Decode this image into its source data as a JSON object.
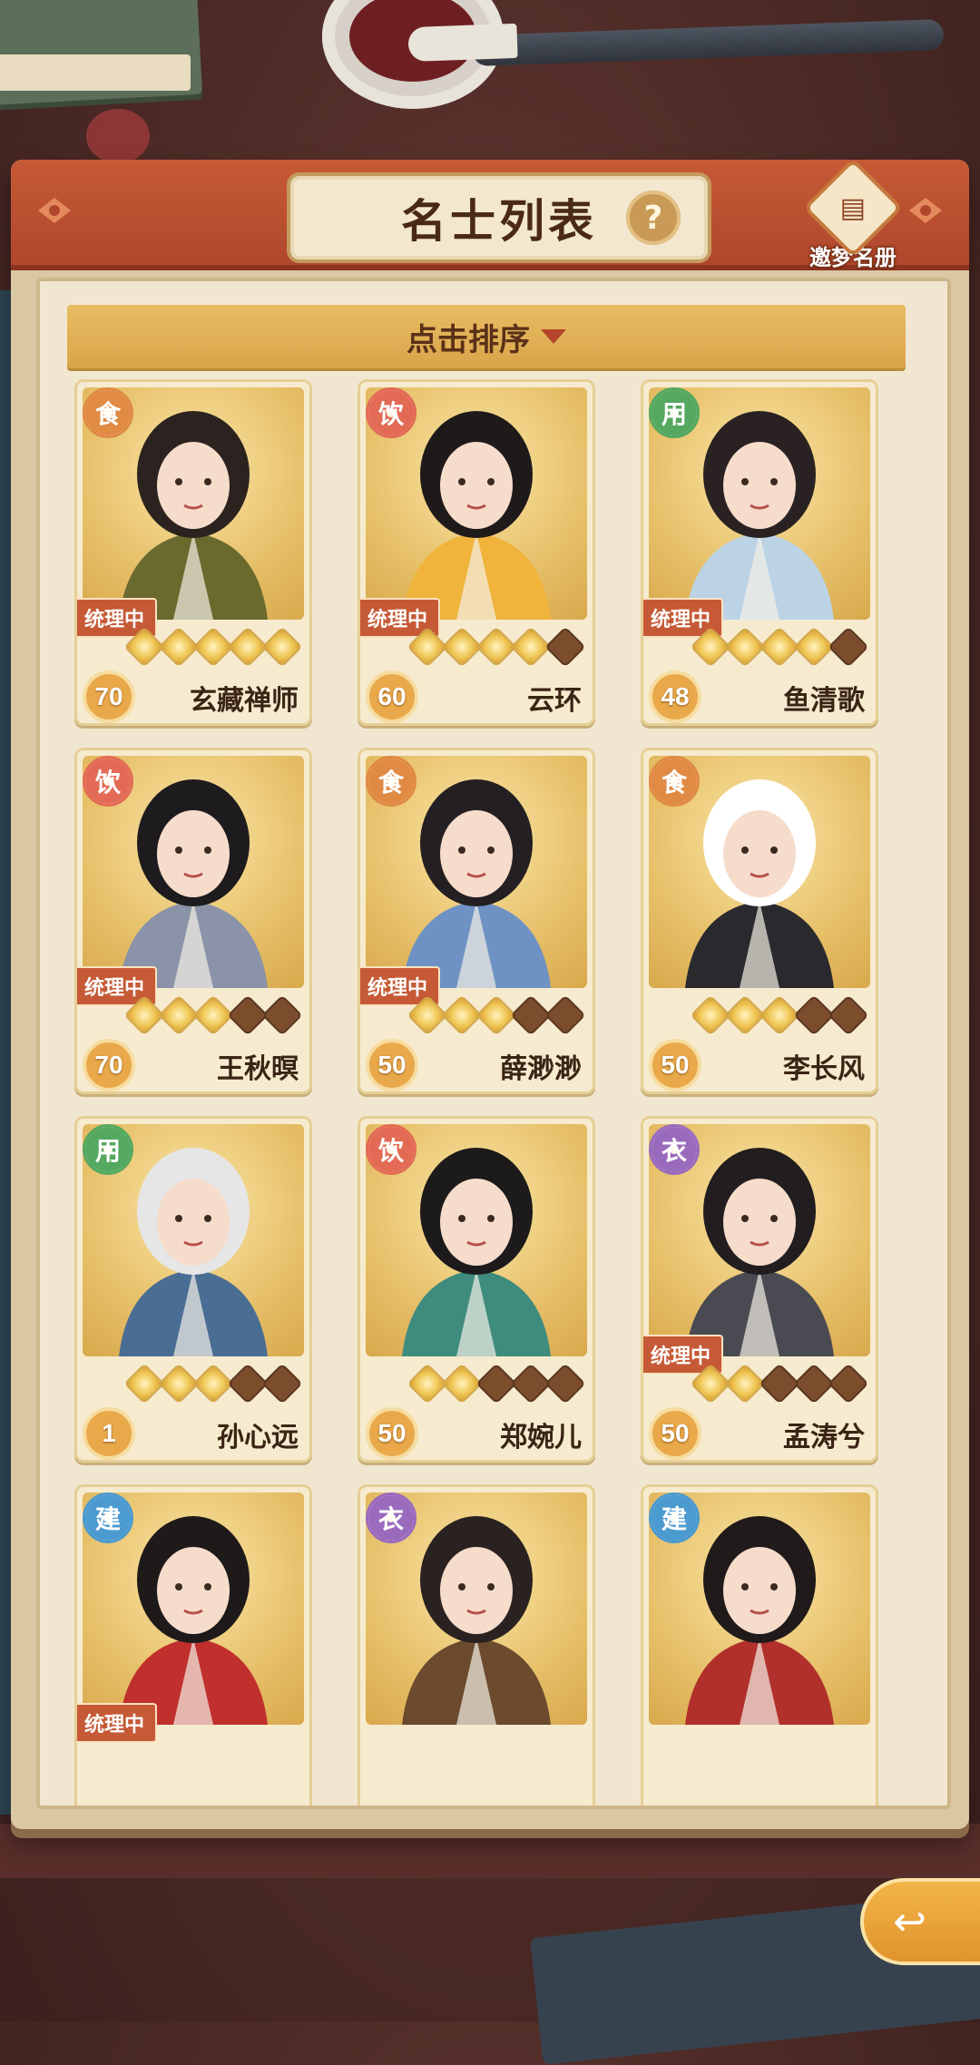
{
  "header": {
    "title": "名士列表",
    "help_icon": "?",
    "dream_label": "邀梦名册"
  },
  "sort": {
    "label": "点击排序"
  },
  "colors": {
    "food": "#e08a44",
    "drink": "#e36b55",
    "use": "#55a860",
    "cloth": "#9a6bbd",
    "build": "#4b9ad0",
    "tag_bg": "#c65a36"
  },
  "characters": [
    {
      "name": "玄藏禅师",
      "category": "食",
      "cat_color": "#e08a44",
      "level": "70",
      "stars": 5,
      "status": "统理中"
    },
    {
      "name": "云环",
      "category": "饮",
      "cat_color": "#e36b55",
      "level": "60",
      "stars": 4,
      "status": "统理中"
    },
    {
      "name": "鱼清歌",
      "category": "用",
      "cat_color": "#55a860",
      "level": "48",
      "stars": 4,
      "status": "统理中"
    },
    {
      "name": "王秋暝",
      "category": "饮",
      "cat_color": "#e36b55",
      "level": "70",
      "stars": 3,
      "status": "统理中"
    },
    {
      "name": "薛渺渺",
      "category": "食",
      "cat_color": "#e08a44",
      "level": "50",
      "stars": 3,
      "status": "统理中"
    },
    {
      "name": "李长风",
      "category": "食",
      "cat_color": "#e08a44",
      "level": "50",
      "stars": 3,
      "status": ""
    },
    {
      "name": "孙心远",
      "category": "用",
      "cat_color": "#55a860",
      "level": "1",
      "stars": 3,
      "status": ""
    },
    {
      "name": "郑婉儿",
      "category": "饮",
      "cat_color": "#e36b55",
      "level": "50",
      "stars": 2,
      "status": ""
    },
    {
      "name": "孟涛兮",
      "category": "衣",
      "cat_color": "#9a6bbd",
      "level": "50",
      "stars": 2,
      "status": "统理中"
    },
    {
      "name": "",
      "category": "建",
      "cat_color": "#4b9ad0",
      "level": "",
      "stars": 0,
      "status": "统理中"
    },
    {
      "name": "",
      "category": "衣",
      "cat_color": "#9a6bbd",
      "level": "",
      "stars": 0,
      "status": ""
    },
    {
      "name": "",
      "category": "建",
      "cat_color": "#4b9ad0",
      "level": "",
      "stars": 0,
      "status": ""
    }
  ],
  "icons": {
    "back": "back-arrow-icon",
    "help": "question-icon",
    "dream": "book-icon"
  }
}
